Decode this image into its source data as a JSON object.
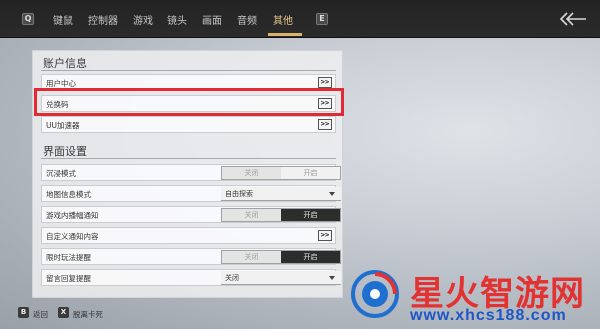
{
  "topbar": {
    "left_key": "Q",
    "right_key": "E",
    "tabs": [
      {
        "label": "键鼠",
        "active": false
      },
      {
        "label": "控制器",
        "active": false
      },
      {
        "label": "游戏",
        "active": false
      },
      {
        "label": "镜头",
        "active": false
      },
      {
        "label": "画面",
        "active": false
      },
      {
        "label": "音频",
        "active": false
      },
      {
        "label": "其他",
        "active": true
      }
    ],
    "back_icon": "back-arrow-icon"
  },
  "sections": {
    "account_title": "账户信息",
    "interface_title": "界面设置"
  },
  "account_rows": [
    {
      "label": "用户中心",
      "control": ">>"
    },
    {
      "label": "兑换码",
      "control": ">>"
    },
    {
      "label": "UU加速器",
      "control": ">>"
    }
  ],
  "interface_rows": {
    "immersive": {
      "label": "沉浸模式",
      "off": "关闭",
      "on": "开启",
      "selected": "关闭"
    },
    "map_info": {
      "label": "地图信息模式",
      "value": "自由探索"
    },
    "ingame_broadcast": {
      "label": "游戏内播幅通知",
      "off": "关闭",
      "on": "开启",
      "selected": "开启"
    },
    "custom_notify": {
      "label": "自定义通知内容",
      "control": ">>"
    },
    "limited_play": {
      "label": "限时玩法提醒",
      "off": "关闭",
      "on": "开启",
      "selected": "开启"
    },
    "message_reply": {
      "label": "留言回复提醒",
      "value": "关闭"
    }
  },
  "footer": {
    "back_key": "B",
    "back_label": "返回",
    "stuck_key": "X",
    "stuck_label": "脱离卡死"
  },
  "watermark": {
    "title": "星火智游网",
    "url": "www.xhcs188.com"
  },
  "colors": {
    "highlight_border": "#e12a33",
    "active_tab": "#e8c98c",
    "toggle_on": "#2d2d2d",
    "watermark_red": "#e23232",
    "watermark_blue": "#1f56c6"
  }
}
